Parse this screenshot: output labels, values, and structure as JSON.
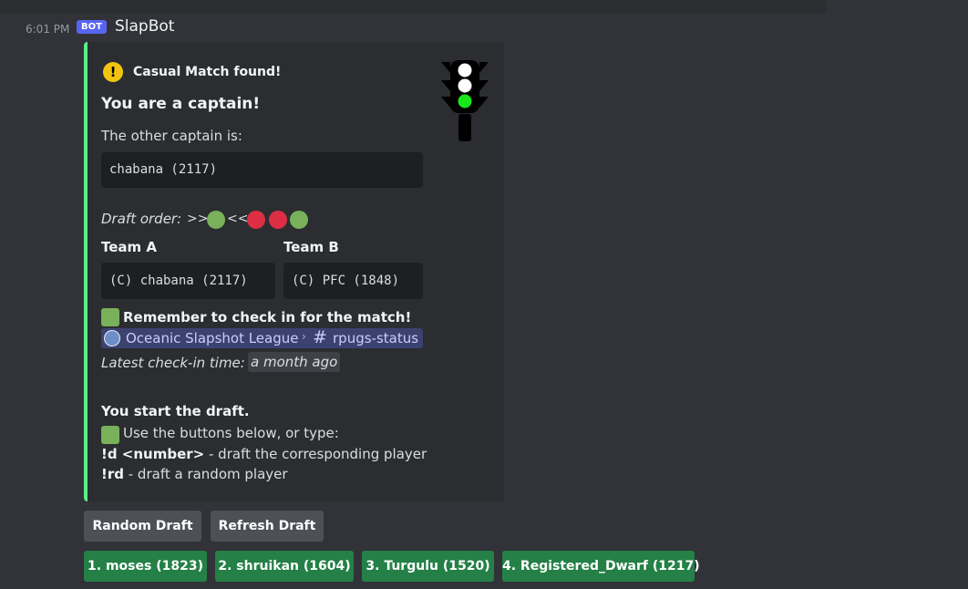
{
  "message": {
    "timestamp": "6:01 PM",
    "bot_badge": "BOT",
    "username": "SlapBot"
  },
  "embed": {
    "accent_color": "#57f287",
    "author": "Casual Match found!",
    "title": "You are a captain!",
    "other_captain_label": "The other captain is:",
    "other_captain": "chabana (2117)",
    "draft_order_label": "Draft order:",
    "draft_order_forward": ">>",
    "draft_order_back": "<<",
    "draft_order_dots": [
      "green",
      "red",
      "red",
      "green"
    ],
    "team_a": {
      "label": "Team A",
      "members": "(C) chabana (2117)"
    },
    "team_b": {
      "label": "Team B",
      "members": "(C) PFC (1848)"
    },
    "remember": "Remember to check in for the match!",
    "channel_mention": {
      "guild": "Oceanic Slapshot League",
      "channel": "rpugs-status"
    },
    "checkin_label": "Latest check-in time:",
    "checkin_time": "a month ago",
    "start_draft": "You start the draft.",
    "use_buttons": "Use the buttons below, or type:",
    "commands": [
      {
        "cmd": "!d <number>",
        "desc": " - draft the corresponding player"
      },
      {
        "cmd": "!rd",
        "desc": " - draft a random player"
      }
    ]
  },
  "buttons": {
    "random_draft": "Random Draft",
    "refresh_draft": "Refresh Draft",
    "players": [
      "1. moses (1823)",
      "2. shruikan (1604)",
      "3. Turgulu (1520)",
      "4. Registered_Dwarf (1217)"
    ]
  }
}
